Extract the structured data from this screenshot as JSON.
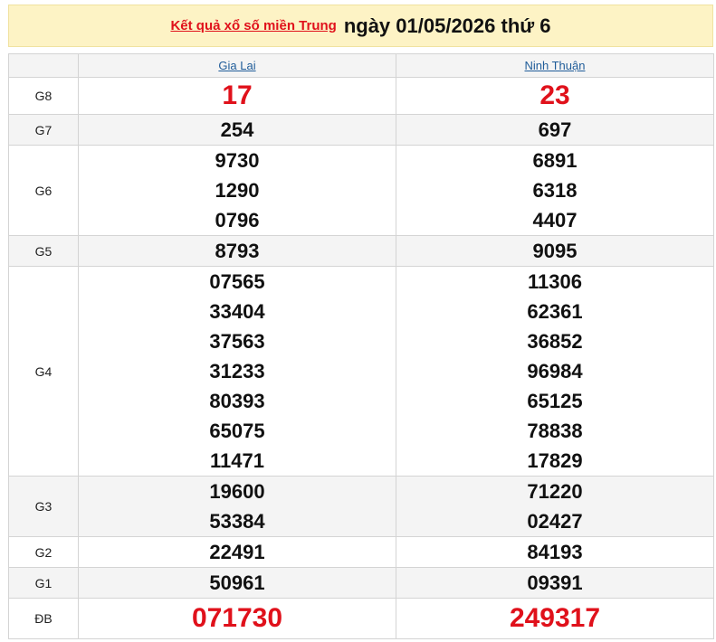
{
  "header": {
    "link_label": "Kết quả xổ số miền Trung",
    "date_label": "ngày 01/05/2026 thứ 6"
  },
  "provinces": [
    "Gia Lai",
    "Ninh Thuận"
  ],
  "prizes": [
    {
      "label": "G8",
      "a": [
        "17"
      ],
      "b": [
        "23"
      ]
    },
    {
      "label": "G7",
      "a": [
        "254"
      ],
      "b": [
        "697"
      ]
    },
    {
      "label": "G6",
      "a": [
        "9730",
        "1290",
        "0796"
      ],
      "b": [
        "6891",
        "6318",
        "4407"
      ]
    },
    {
      "label": "G5",
      "a": [
        "8793"
      ],
      "b": [
        "9095"
      ]
    },
    {
      "label": "G4",
      "a": [
        "07565",
        "33404",
        "37563",
        "31233",
        "80393",
        "65075",
        "11471"
      ],
      "b": [
        "11306",
        "62361",
        "36852",
        "96984",
        "65125",
        "78838",
        "17829"
      ]
    },
    {
      "label": "G3",
      "a": [
        "19600",
        "53384"
      ],
      "b": [
        "71220",
        "02427"
      ]
    },
    {
      "label": "G2",
      "a": [
        "22491"
      ],
      "b": [
        "84193"
      ]
    },
    {
      "label": "G1",
      "a": [
        "50961"
      ],
      "b": [
        "09391"
      ]
    },
    {
      "label": "ĐB",
      "a": [
        "071730"
      ],
      "b": [
        "249317"
      ]
    }
  ],
  "colors": {
    "accent_red": "#e0111b",
    "header_bg": "#fdf3c5",
    "link_blue": "#1f5c99"
  }
}
